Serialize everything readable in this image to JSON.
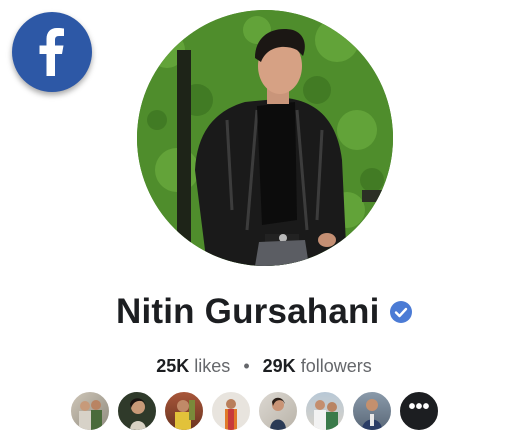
{
  "profile": {
    "name": "Nitin Gursahani",
    "likes_count": "25K",
    "likes_label": "likes",
    "separator": "•",
    "followers_count": "29K",
    "followers_label": "followers",
    "verified_color": "#4b7bd5"
  },
  "brand": {
    "icon": "facebook-icon",
    "color": "#2d58a6"
  },
  "friends": {
    "more_label": "•••",
    "count_shown": 8
  }
}
